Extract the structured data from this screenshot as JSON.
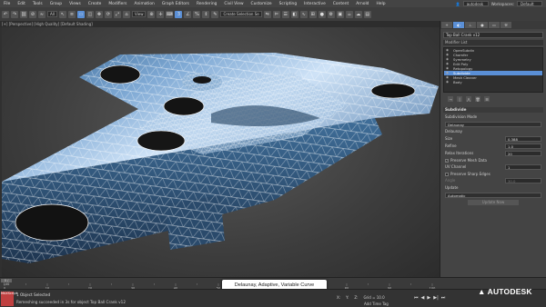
{
  "menu": {
    "items": [
      "File",
      "Edit",
      "Tools",
      "Group",
      "Views",
      "Create",
      "Modifiers",
      "Animation",
      "Graph Editors",
      "Rendering",
      "Civil View",
      "Customize",
      "Scripting",
      "Interactive",
      "Content",
      "Arnold",
      "Help"
    ],
    "user": "autodesk",
    "workspaces_label": "Workspaces:",
    "workspace": "Default"
  },
  "toolbar": {
    "undo_icon": "undo-icon",
    "redo_icon": "redo-icon",
    "selection_filter": "All",
    "ref_coord": "View",
    "named_selection": "Create Selection Se"
  },
  "viewport": {
    "label": "[+] [Perspective] [High Quality] [Default Shading]"
  },
  "command_panel": {
    "object_name": "Top Ball Crank v12",
    "modifier_list_label": "Modifier List",
    "stack": [
      "OpenSubdiv",
      "Chamfer",
      "Symmetry",
      "Edit Poly",
      "Retopology",
      "Subdivide",
      "Mesh Cleaner",
      "Body"
    ],
    "selected_index": 5,
    "rollout_title": "Subdivide",
    "subdivision_method_label": "Subdivision Mode",
    "subdivision_method": "Delaunay",
    "delaunay_label": "Delaunay",
    "size_label": "Size",
    "size_value": "0.388",
    "refine_label": "Refine",
    "refine_value": "1.0",
    "relax_label": "Relax Iterations",
    "relax_value": "20",
    "preserve_mesh": "Preserve Mesh Data",
    "uv_channel_label": "UV Channel",
    "uv_channel_value": "1",
    "preserve_sharp": "Preserve Sharp Edges",
    "angle_label": "Angle",
    "angle_value": "30.0",
    "update_label": "Update",
    "update_mode": "Automatic",
    "update_button": "Update Now"
  },
  "timeline": {
    "slider_text": "0 / 100",
    "ticks": [
      "0",
      "10",
      "20",
      "30",
      "40",
      "50",
      "60",
      "70",
      "80",
      "90",
      "100"
    ]
  },
  "status": {
    "selection": "1 Object Selected",
    "message": "Remeshing succeeded in 3s for object Top Ball Crank v12",
    "x": "X:",
    "y": "Y:",
    "z": "Z:",
    "grid": "Grid = 10.0",
    "add_time_tag": "Add Time Tag",
    "maxscript": "MAXScript"
  },
  "caption": "Delaunay, Adaptive, Variable Curve",
  "brand": {
    "logo_text": "AUTODESK"
  }
}
